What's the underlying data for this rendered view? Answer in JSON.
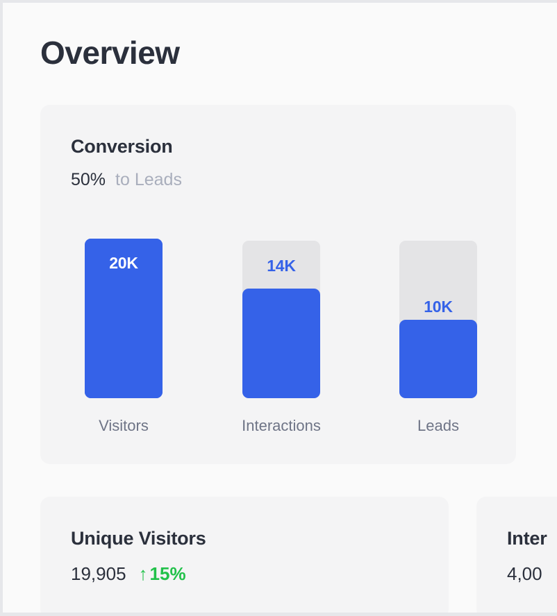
{
  "page": {
    "title": "Overview",
    "background_color": "#FAFAFA",
    "accent_color": "#3562E8",
    "positive_color": "#22C14A",
    "muted_color": "#A9AEBC",
    "track_color": "#E4E4E6",
    "card_color": "#F4F4F5"
  },
  "conversion_card": {
    "title": "Conversion",
    "rate": "50%",
    "rate_caption": "to Leads"
  },
  "stat_cards": [
    {
      "title": "Unique Visitors",
      "value": "19,905",
      "delta": "15%",
      "arrow": "↑",
      "direction": "up"
    },
    {
      "title": "Inter",
      "value": "4,00",
      "truncated": true
    }
  ],
  "chart_data": {
    "type": "bar",
    "title": "Conversion",
    "subtitle": "50% to Leads",
    "categories": [
      "Visitors",
      "Interactions",
      "Leads"
    ],
    "values": [
      20000,
      14000,
      10000
    ],
    "value_labels": [
      "20K",
      "14K",
      "10K"
    ],
    "max": 20000,
    "xlabel": "",
    "ylabel": "",
    "ylim": [
      0,
      20000
    ],
    "grid": false,
    "legend": false,
    "bar_color": "#3562E8",
    "track_color": "#E4E4E6",
    "label_inside": true,
    "notes": "Each bar is drawn on a full-height track; the blue fill height is proportional to the value, the remainder of the track is light grey. The tallest bar (Visitors) fills its track completely."
  }
}
